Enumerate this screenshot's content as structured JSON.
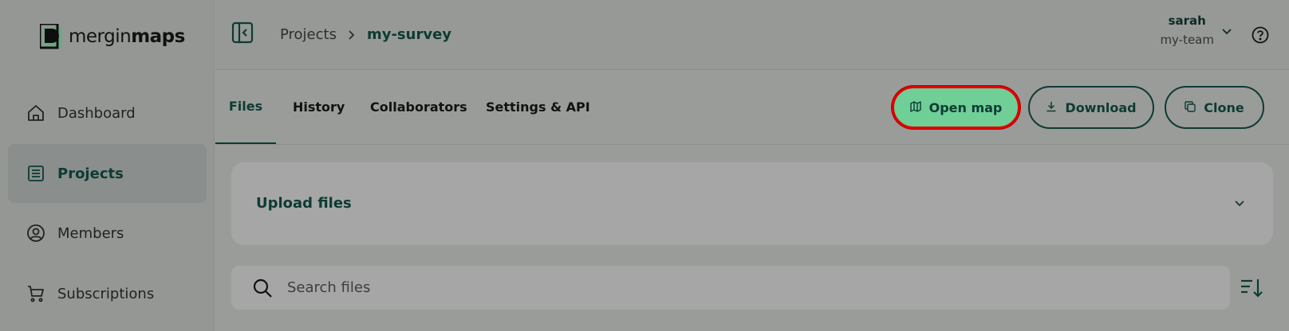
{
  "app": {
    "logo_regular": "mergin",
    "logo_bold": "maps"
  },
  "sidebar": {
    "items": [
      {
        "label": "Dashboard",
        "icon": "home-icon"
      },
      {
        "label": "Projects",
        "icon": "list-icon",
        "active": true
      },
      {
        "label": "Members",
        "icon": "user-circle-icon"
      },
      {
        "label": "Subscriptions",
        "icon": "cart-icon"
      }
    ]
  },
  "header": {
    "breadcrumb_parent": "Projects",
    "breadcrumb_current": "my-survey",
    "user_name": "sarah",
    "user_team": "my-team"
  },
  "tabs": [
    {
      "label": "Files",
      "active": true
    },
    {
      "label": "History"
    },
    {
      "label": "Collaborators"
    },
    {
      "label": "Settings & API"
    }
  ],
  "actions": {
    "open_map": "Open map",
    "download": "Download",
    "clone": "Clone"
  },
  "upload": {
    "title": "Upload files"
  },
  "search": {
    "placeholder": "Search files"
  },
  "colors": {
    "brand_dark": "#0d3b33",
    "primary_button": "#6fcf97",
    "highlight": "#e00000"
  }
}
